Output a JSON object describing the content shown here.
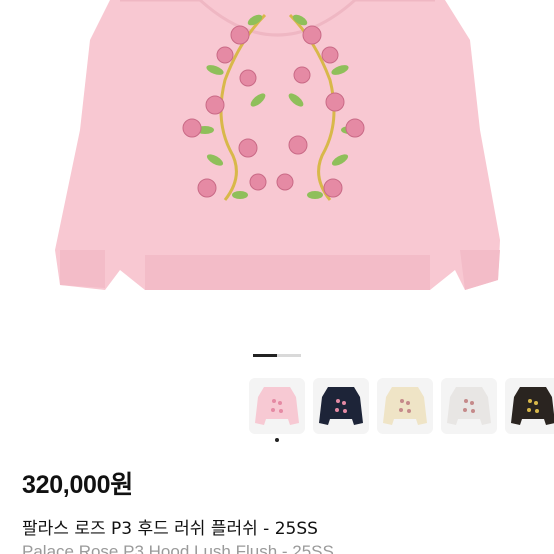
{
  "product": {
    "main_image": "rose-hoodie-pink-image",
    "price": "320,000원",
    "title_ko": "팔라스 로즈 P3 후드 러쉬 플러쉬 - 25SS",
    "title_en": "Palace Rose P3 Hood Lush Flush - 25SS"
  },
  "gallery": {
    "current_index": 1,
    "total": 2
  },
  "variants": [
    {
      "name": "pink-hoodie-thumbnail",
      "color": "#f7c9d3"
    },
    {
      "name": "navy-hoodie-thumbnail",
      "color": "#1d2438"
    },
    {
      "name": "cream-hoodie-thumbnail",
      "color": "#efe4c6"
    },
    {
      "name": "grey-hoodie-thumbnail",
      "color": "#e8e6e4"
    },
    {
      "name": "black-hoodie-thumbnail",
      "color": "#2a2420"
    }
  ],
  "selected_variant": 0,
  "colors": {
    "hoodie_pink": "#f8c8d2",
    "rose": "#e58aa4",
    "leaf": "#8fbf5a",
    "stem": "#d8b84a"
  }
}
